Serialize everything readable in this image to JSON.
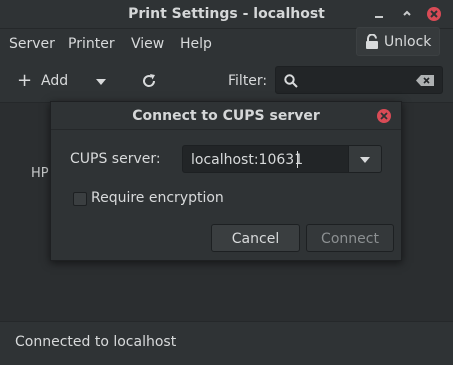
{
  "window": {
    "title": "Print Settings - localhost"
  },
  "menubar": {
    "items": [
      "Server",
      "Printer",
      "View",
      "Help"
    ],
    "unlock_label": "Unlock"
  },
  "toolbar": {
    "add_label": "Add",
    "filter_label": "Filter:",
    "filter_value": ""
  },
  "main": {
    "printer_label": "HP"
  },
  "dialog": {
    "title": "Connect to CUPS server",
    "server_label": "CUPS server:",
    "server_value": "localhost:10631",
    "encryption_label": "Require encryption",
    "encryption_checked": false,
    "cancel_label": "Cancel",
    "connect_label": "Connect"
  },
  "status": {
    "text": "Connected to localhost"
  },
  "colors": {
    "close_red": "#d94b56",
    "background": "#2b2e30",
    "text": "#d8dadb"
  }
}
